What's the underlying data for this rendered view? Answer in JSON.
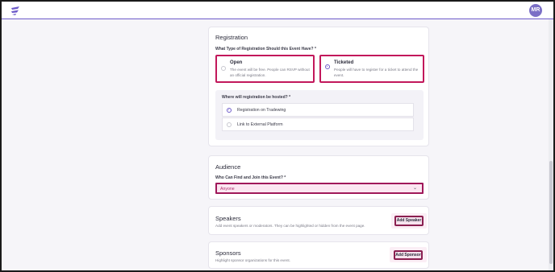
{
  "header": {
    "avatar_initials": "MR"
  },
  "registration": {
    "title": "Registration",
    "question": "What Type of Registration Should this Event Have? *",
    "options": [
      {
        "title": "Open",
        "desc": "The event will be free. People can RSVP without an official registration.",
        "selected": false
      },
      {
        "title": "Ticketed",
        "desc": "People will have to register for a ticket to attend the event.",
        "selected": true
      }
    ],
    "hosted_question": "Where will registration be hosted? *",
    "hosted_options": [
      {
        "label": "Registration on Tradewing",
        "selected": true
      },
      {
        "label": "Link to External Platform",
        "selected": false
      }
    ]
  },
  "audience": {
    "title": "Audience",
    "question": "Who Can Find and Join this Event? *",
    "selected_value": "Anyone"
  },
  "speakers": {
    "title": "Speakers",
    "desc": "Add event speakers or moderators. They can be highlighted or hidden from the event page.",
    "button_label": "Add Speaker"
  },
  "sponsors": {
    "title": "Sponsors",
    "desc": "Highlight sponsor organizations for this event.",
    "button_label": "Add Sponsor"
  },
  "colors": {
    "accent": "#6d5ac9",
    "highlight": "#c2185b"
  }
}
